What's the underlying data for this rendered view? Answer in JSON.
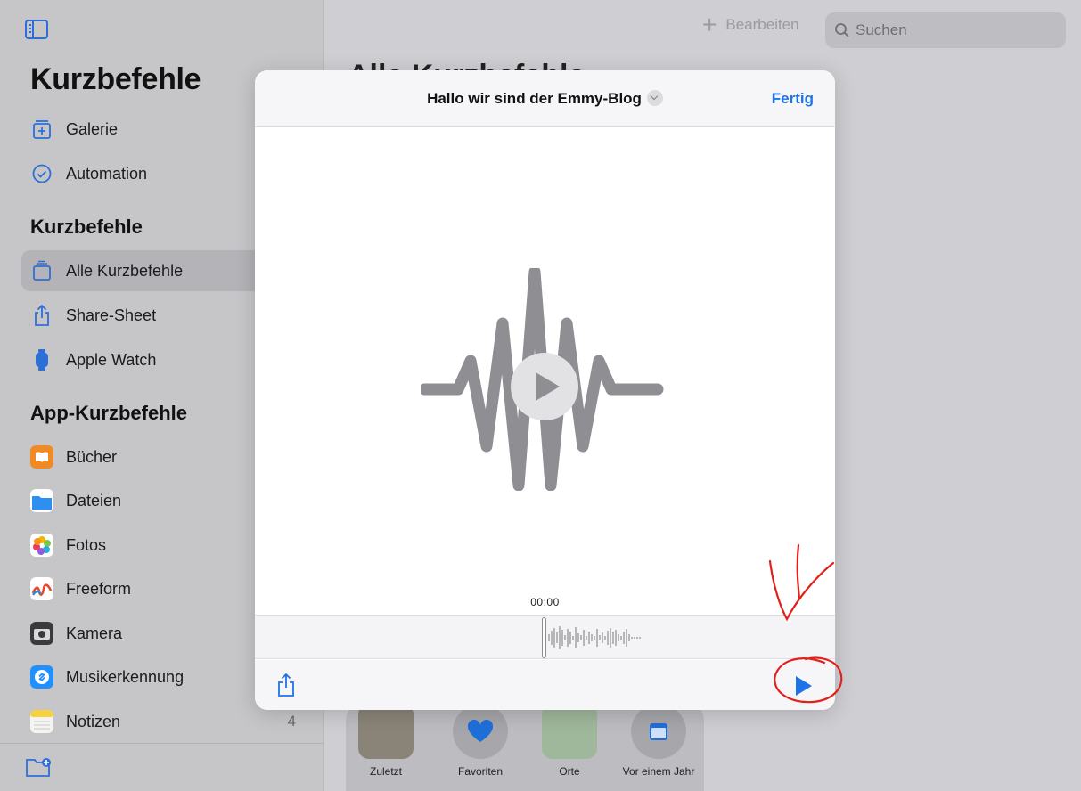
{
  "sidebar": {
    "title": "Kurzbefehle",
    "top_items": [
      {
        "label": "Galerie",
        "icon": "gallery-icon"
      },
      {
        "label": "Automation",
        "icon": "clock-check-icon"
      }
    ],
    "section_shortcuts": "Kurzbefehle",
    "shortcut_items": [
      {
        "label": "Alle Kurzbefehle",
        "icon": "stack-icon",
        "selected": true
      },
      {
        "label": "Share-Sheet",
        "icon": "share-icon"
      },
      {
        "label": "Apple Watch",
        "icon": "watch-icon"
      }
    ],
    "section_apps": "App-Kurzbefehle",
    "app_items": [
      {
        "label": "Bücher",
        "icon": "books-app-icon",
        "color": "#f08a24"
      },
      {
        "label": "Dateien",
        "icon": "files-app-icon",
        "color": "#2f8ff0"
      },
      {
        "label": "Fotos",
        "icon": "photos-app-icon",
        "color": "#f5b400"
      },
      {
        "label": "Freeform",
        "icon": "freeform-app-icon",
        "color": "#ffffff"
      },
      {
        "label": "Kamera",
        "icon": "camera-app-icon",
        "color": "#3a3a3c"
      },
      {
        "label": "Musikerkennung",
        "icon": "shazam-app-icon",
        "color": "#1e90ff"
      },
      {
        "label": "Notizen",
        "icon": "notes-app-icon",
        "color": "#f7d23e",
        "count": "4"
      }
    ]
  },
  "main": {
    "title": "Alle Kurzbefehle",
    "edit_label": "Bearbeiten",
    "search_placeholder": "Suchen",
    "widget_items": [
      {
        "label": "Zuletzt"
      },
      {
        "label": "Favoriten"
      },
      {
        "label": "Orte"
      },
      {
        "label": "Vor einem Jahr"
      }
    ]
  },
  "modal": {
    "title": "Hallo wir sind der Emmy-Blog",
    "done_label": "Fertig",
    "timecode": "00:00"
  },
  "colors": {
    "accent": "#1f73e8",
    "annotation": "#e0201b"
  }
}
